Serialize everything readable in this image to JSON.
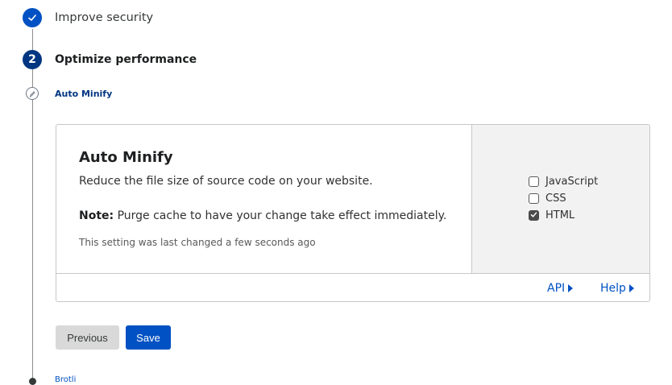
{
  "steps": {
    "step1": {
      "label": "Improve security",
      "state": "completed"
    },
    "step2": {
      "number": "2",
      "label": "Optimize performance",
      "state": "active"
    },
    "substep": {
      "label": "Auto Minify"
    },
    "next_substep": {
      "label": "Brotli"
    }
  },
  "card": {
    "title": "Auto Minify",
    "description": "Reduce the file size of source code on your website.",
    "note_bold": "Note:",
    "note_text": " Purge cache to have your change take effect immediately.",
    "last_changed": "This setting was last changed a few seconds ago",
    "options": [
      {
        "label": "JavaScript",
        "checked": false
      },
      {
        "label": "CSS",
        "checked": false
      },
      {
        "label": "HTML",
        "checked": true
      }
    ],
    "footer_links": {
      "api": "API",
      "help": "Help"
    }
  },
  "buttons": {
    "previous": "Previous",
    "save": "Save"
  },
  "colors": {
    "accent": "#0051c3",
    "step_active": "#003681",
    "text": "#313131",
    "panel_bg": "#f2f2f2"
  },
  "icons": {
    "step1": "check-icon",
    "substep": "pencil-icon",
    "checked": "checkmark-icon",
    "link_arrow": "triangle-right-icon"
  }
}
